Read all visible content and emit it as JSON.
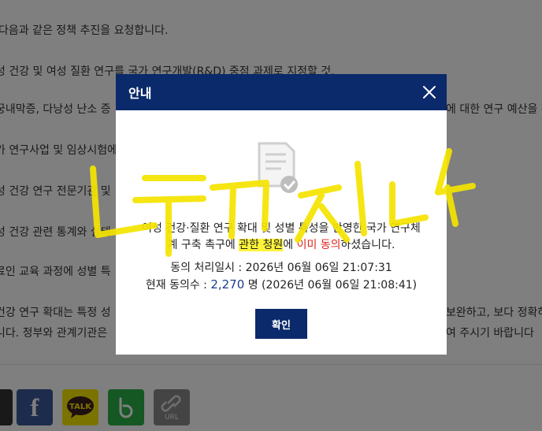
{
  "background": {
    "lines": [
      "다음과 같은 정책 추진을 요청합니다.",
      "성 건강 및 여성 질환 연구를 국가 연구개발(R&D) 중점 과제로 지정할 것.",
      "궁내막증, 다낭성 난소 증",
      "가 연구사업 및 임상시험에",
      "성 건강 연구 전문기관 및",
      "성 건강 관련 통계와 실태",
      "료인 교육 과정에 성별 특",
      "건강 연구 확대는 특정 성",
      "니다. 정부와 관계기관은"
    ],
    "right_fragments": [
      "에 대한 연구 예산을 확",
      "보완하고, 보다 정확하",
      "여 주시기 바랍니다"
    ]
  },
  "modal": {
    "title": "안내",
    "message_parts": {
      "p1": "여성 건강·질환 연구 ",
      "p2": "확대",
      "p3": " 및 성별 특성을 반영한 국가 연구체",
      "p4": "계 구축 촉구에 ",
      "p5": "관한 청원",
      "p6": "에 ",
      "p7": "이미 동의",
      "p8": "하셨습니다."
    },
    "processed_label": "동의 처리일시 : ",
    "processed_value": "2026년 06월 06일 21:07:31",
    "count_label": "현재 동의수 : ",
    "count_value": "2,270",
    "count_suffix": " 명 (2026년 06월 06일 21:08:41)",
    "confirm_label": "확인"
  },
  "share": {
    "talk_label": "TALK",
    "url_label": "URL"
  },
  "colors": {
    "header": "#0b2a6b",
    "facebook": "#3b5998",
    "kakao": "#f7e600",
    "band": "#2ab049",
    "url": "#888888",
    "scribble": "#f5e400"
  },
  "icons": [
    "close-icon",
    "document-check-icon",
    "facebook-icon",
    "kakaotalk-icon",
    "band-icon",
    "link-url-icon"
  ]
}
